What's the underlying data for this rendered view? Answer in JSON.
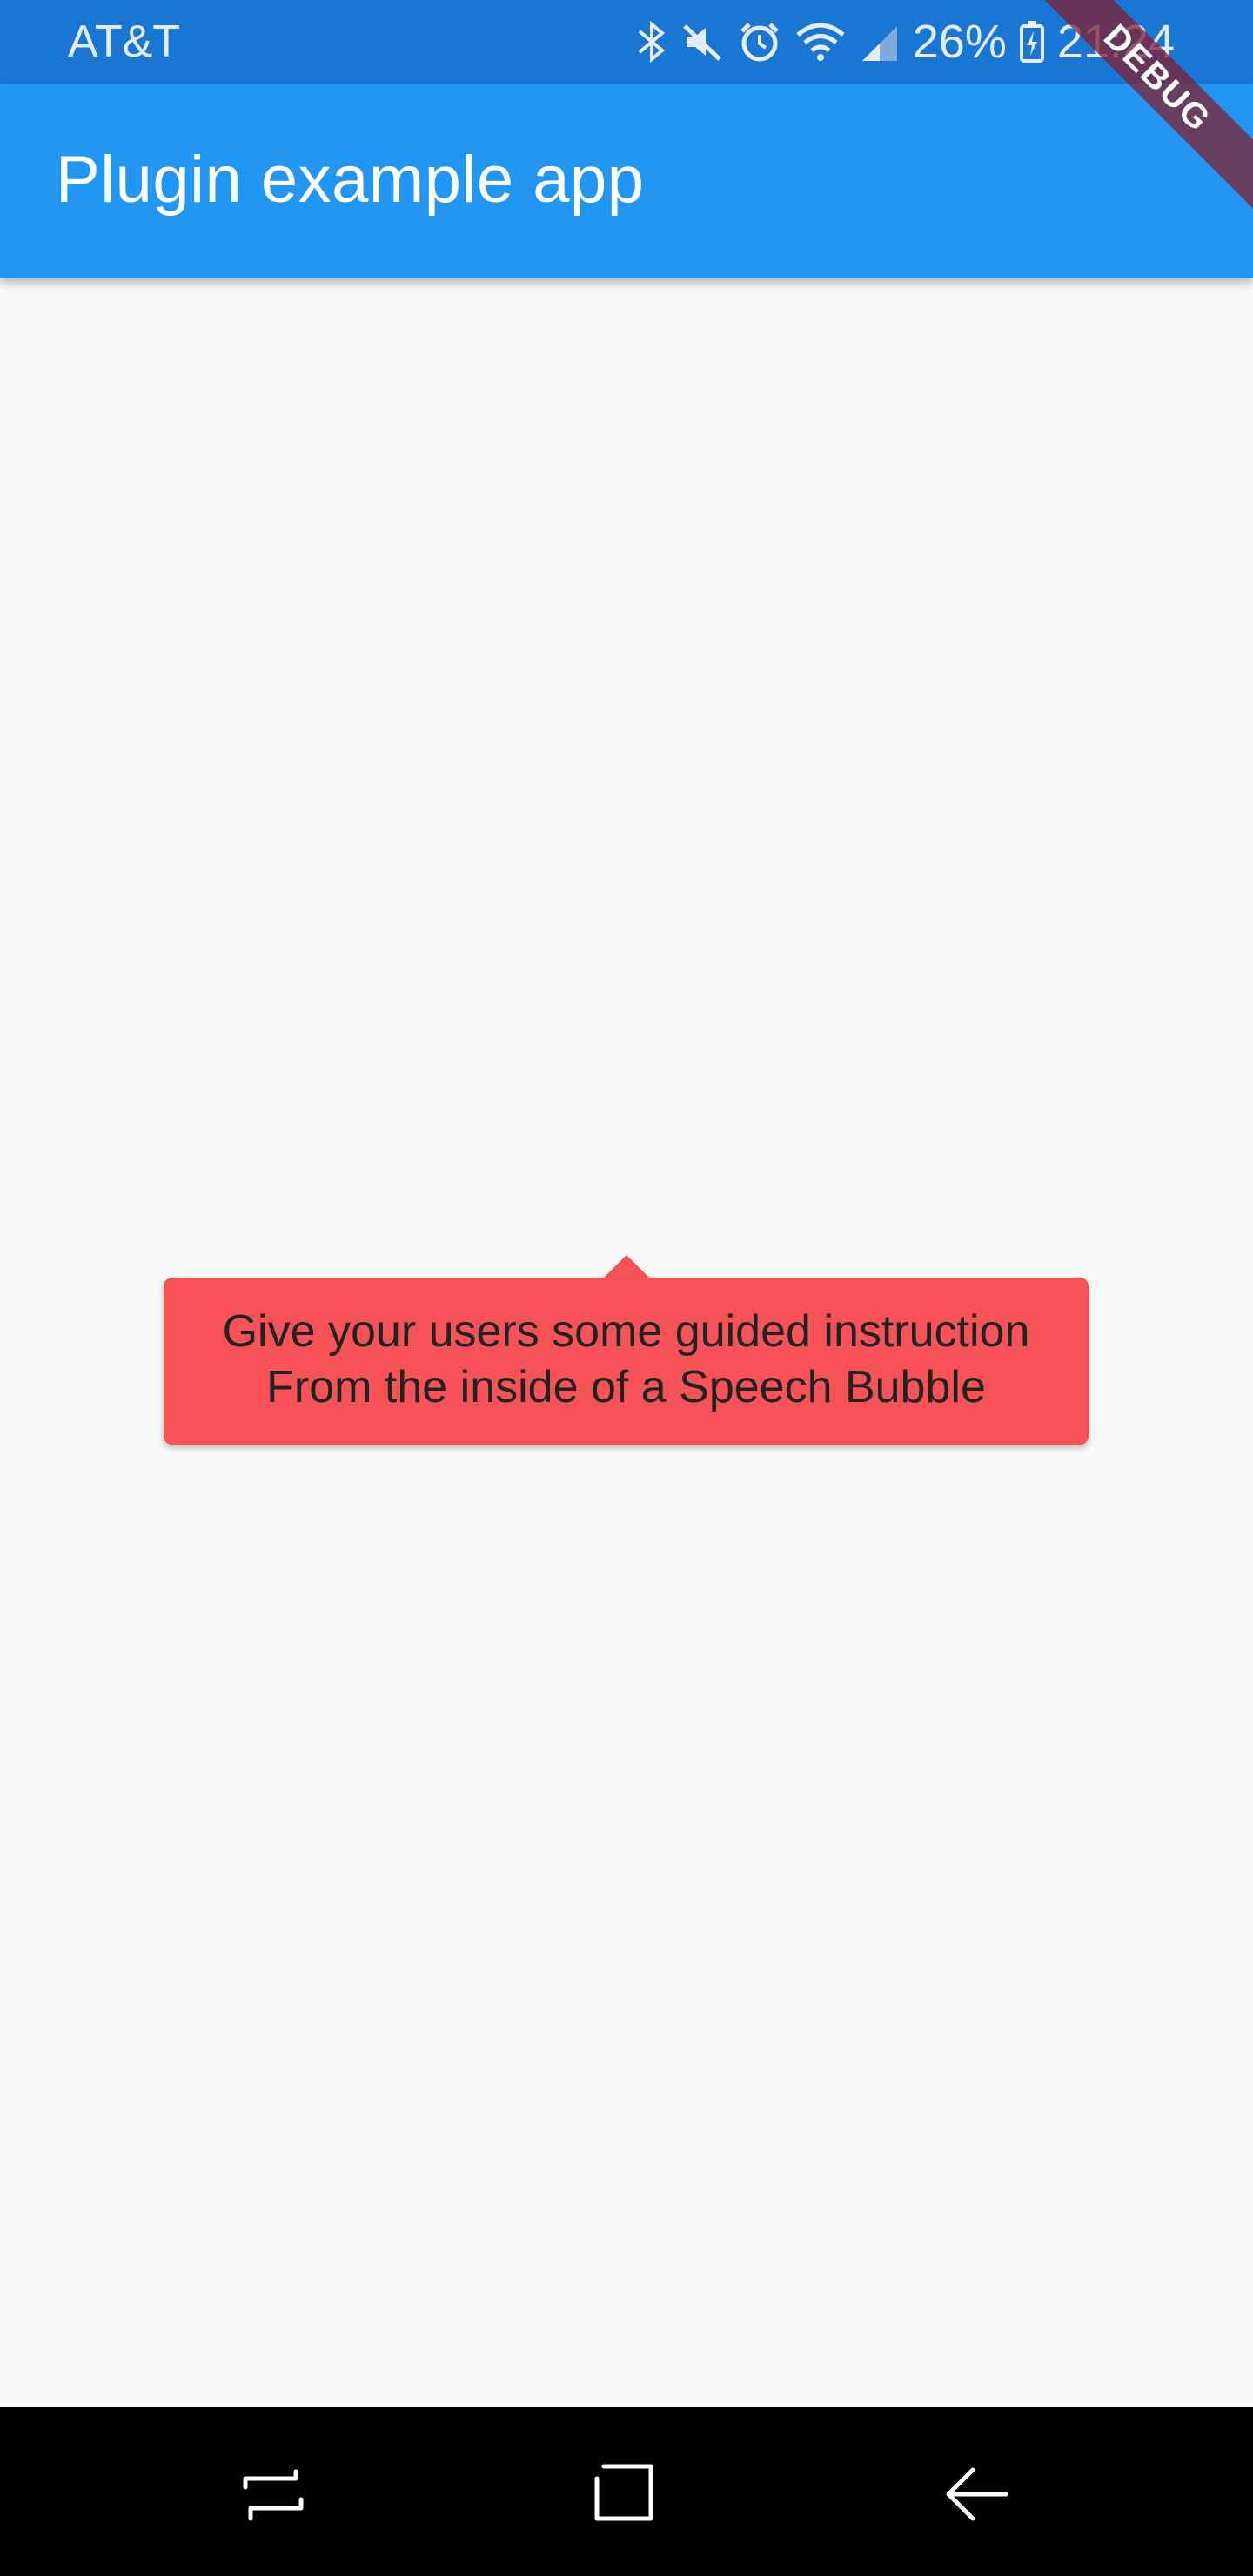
{
  "status_bar": {
    "carrier": "AT&T",
    "battery_percent": "26%",
    "time": "21:24",
    "icons": [
      "bluetooth-icon",
      "mute-icon",
      "alarm-icon",
      "wifi-icon",
      "signal-icon",
      "battery-charging-icon"
    ]
  },
  "app_bar": {
    "title": "Plugin example app",
    "color": "#2196f3"
  },
  "debug_banner": {
    "label": "DEBUG"
  },
  "speech_bubble": {
    "line1": "Give your users some guided instruction",
    "line2": "From the inside of a Speech Bubble",
    "color": "#f75357"
  },
  "nav_bar": {
    "buttons": [
      "recents-icon",
      "home-icon",
      "back-icon"
    ]
  }
}
